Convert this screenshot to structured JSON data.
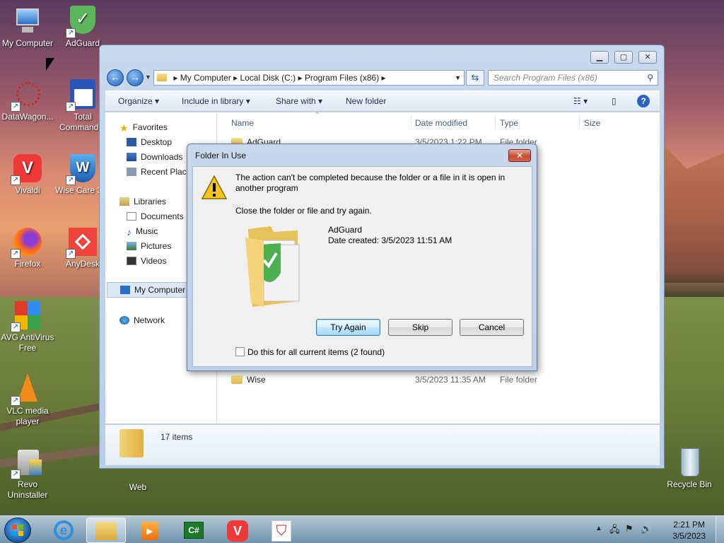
{
  "desktop": {
    "icons": [
      {
        "label": "My Computer",
        "icon": "computer-icon"
      },
      {
        "label": "AdGuard",
        "icon": "adguard-icon"
      },
      {
        "label": "DataWagon...",
        "icon": "datawagon-icon"
      },
      {
        "label": "Total Commander",
        "icon": "total-commander-icon"
      },
      {
        "label": "Vivaldi",
        "icon": "vivaldi-icon"
      },
      {
        "label": "Wise Care 3",
        "icon": "wise-care-icon"
      },
      {
        "label": "Firefox",
        "icon": "firefox-icon"
      },
      {
        "label": "AnyDesk",
        "icon": "anydesk-icon"
      },
      {
        "label": "AVG AntiVirus Free",
        "icon": "avg-icon"
      },
      {
        "label": "VLC media player",
        "icon": "vlc-icon"
      },
      {
        "label": "Revo Uninstaller",
        "icon": "revo-icon"
      },
      {
        "label": "Web",
        "icon": "folder-icon"
      },
      {
        "label": "Recycle Bin",
        "icon": "recycle-bin-icon"
      }
    ]
  },
  "explorer": {
    "breadcrumb": [
      "My Computer",
      "Local Disk (C:)",
      "Program Files (x86)"
    ],
    "search_placeholder": "Search Program Files (x86)",
    "toolbar": {
      "organize": "Organize",
      "include_in_library": "Include in library",
      "share_with": "Share with",
      "new_folder": "New folder"
    },
    "nav": {
      "favorites": "Favorites",
      "desktop": "Desktop",
      "downloads": "Downloads",
      "recent_places": "Recent Places",
      "libraries": "Libraries",
      "documents": "Documents",
      "music": "Music",
      "pictures": "Pictures",
      "videos": "Videos",
      "my_computer": "My Computer",
      "network": "Network"
    },
    "columns": {
      "name": "Name",
      "date_modified": "Date modified",
      "type": "Type",
      "size": "Size"
    },
    "rows": [
      {
        "name": "AdGuard",
        "date": "3/5/2023 1:22 PM",
        "type": "File folder"
      },
      {
        "name": "Wise",
        "date": "3/5/2023 11:35 AM",
        "type": "File folder"
      }
    ],
    "status": "17 items"
  },
  "dialog": {
    "title": "Folder In Use",
    "message": "The action can't be completed because the folder or a file in it is open in another program",
    "instruction": "Close the folder or file and try again.",
    "file_name": "AdGuard",
    "file_created": "Date created: 3/5/2023 11:51 AM",
    "buttons": {
      "try_again": "Try Again",
      "skip": "Skip",
      "cancel": "Cancel"
    },
    "checkbox_label": "Do this for all current items (2 found)",
    "checkbox_checked": false
  },
  "taskbar": {
    "apps": [
      "internet-explorer-icon",
      "windows-explorer-icon",
      "media-player-icon",
      "csharp-icon",
      "vivaldi-icon",
      "adguard-icon"
    ],
    "clock_time": "2:21 PM",
    "clock_date": "3/5/2023"
  }
}
